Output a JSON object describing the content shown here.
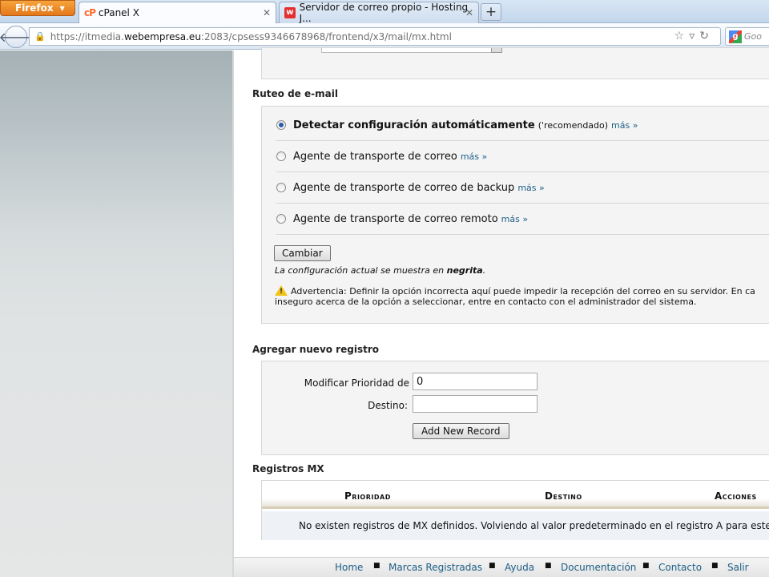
{
  "browser": {
    "menu_label": "Firefox",
    "tabs": [
      {
        "label": "cPanel X",
        "icon": "cp"
      },
      {
        "label": "Servidor de correo propio - Hosting J...",
        "icon": "w"
      }
    ],
    "new_tab": "+",
    "url_prefix": "https://itmedia.",
    "url_domain": "webempresa.eu",
    "url_rest": ":2083/cpsess9346678968/frontend/x3/mail/mx.html",
    "search_placeholder": "Goo",
    "search_engine_icon": "g"
  },
  "routing": {
    "title": "Ruteo de e-mail",
    "options": [
      {
        "label": "Detectar configuración automáticamente",
        "bold": true,
        "note": "('recomendado)",
        "more": "más »",
        "selected": true
      },
      {
        "label": "Agente de transporte de correo",
        "more": "más »",
        "selected": false
      },
      {
        "label": "Agente de transporte de correo de backup",
        "more": "más »",
        "selected": false
      },
      {
        "label": "Agente de transporte de correo remoto",
        "more": "más »",
        "selected": false
      }
    ],
    "change_button": "Cambiar",
    "current_note_prefix": "La configuración actual se muestra en ",
    "current_note_bold": "negrita",
    "current_note_suffix": ".",
    "warning_line1": "Advertencia: Definir la opción incorrecta aquí puede impedir la recepción del correo en su servidor. En ca",
    "warning_line2": "inseguro acerca de la opción a seleccionar, entre en contacto con el administrador del sistema."
  },
  "add_record": {
    "title": "Agregar nuevo registro",
    "priority_label": "Modificar Prioridad de",
    "priority_value": "0",
    "destination_label": "Destino:",
    "destination_value": "",
    "submit_button": "Add New Record"
  },
  "mx_records": {
    "title": "Registros MX",
    "columns": [
      "Prioridad",
      "Destino",
      "Acciones"
    ],
    "empty_message": "No existen registros de MX definidos. Volviendo al valor predeterminado en el registro A para este dom"
  },
  "footer": {
    "links": [
      "Home",
      "Marcas Registradas",
      "Ayuda",
      "Documentación",
      "Contacto",
      "Salir"
    ],
    "separator": "■"
  }
}
